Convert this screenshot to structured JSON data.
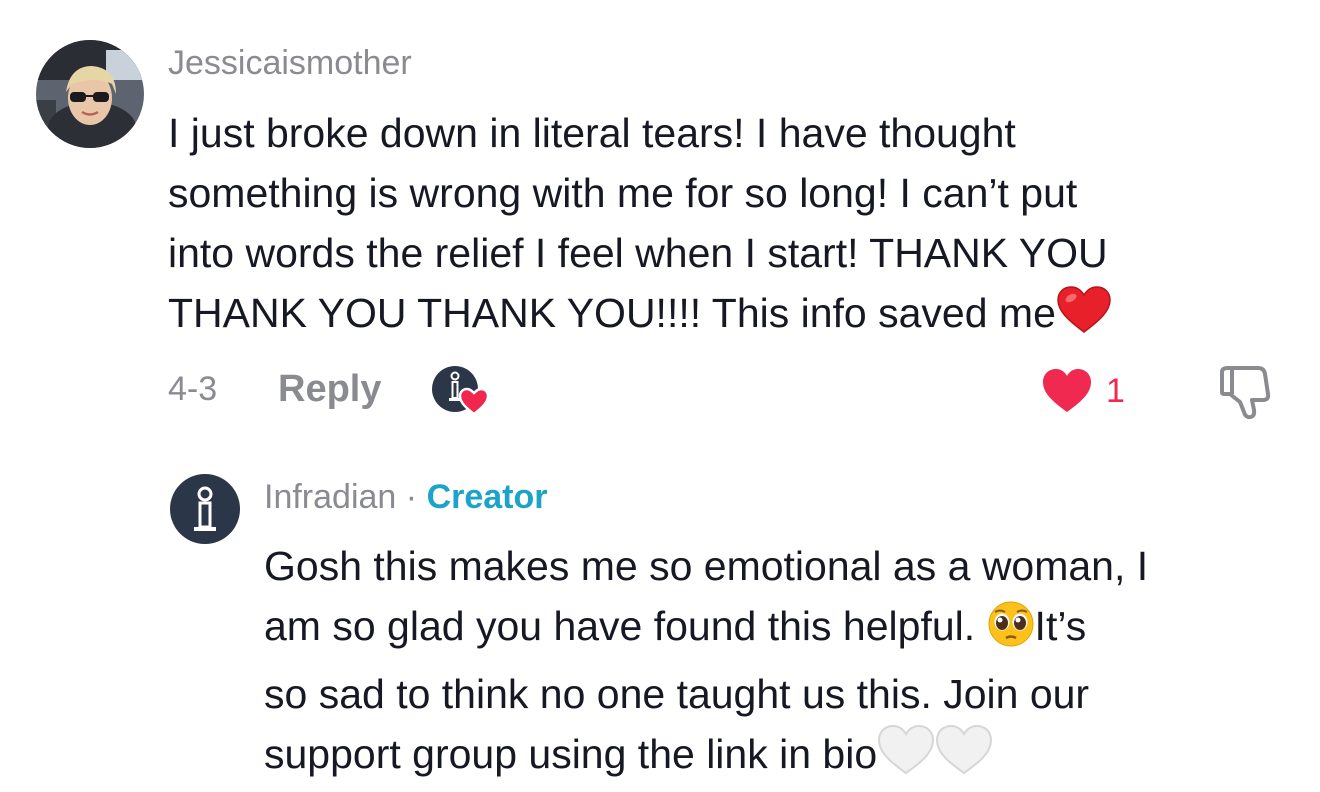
{
  "comments": [
    {
      "username": "Jessicaismother",
      "text_lines": [
        "I just broke down in literal tears! I have thought",
        "something is wrong with me for so long! I can’t put",
        "into words the relief I feel when I start! THANK YOU",
        "THANK YOU THANK YOU!!!! This info saved me"
      ],
      "trailing_emoji": "red-heart",
      "date": "4-3",
      "reply_label": "Reply",
      "creator_liked_icon": "creator-liked-badge",
      "like_count": "1",
      "like_color": "#ef2950",
      "dislike_icon": "thumbs-down-icon"
    },
    {
      "username": "Infradian",
      "separator": "·",
      "badge": "Creator",
      "badge_color": "#1ca3c9",
      "text_lines": [
        "Gosh this makes me so emotional as a woman, I",
        "am so glad you have found this helpful.",
        "so sad to think no one taught us this. Join our",
        "support group using the link in bio"
      ],
      "line2_suffix": "It’s",
      "inline_emoji": "pleading-face",
      "trailing_emojis": [
        "white-heart",
        "white-heart"
      ]
    }
  ]
}
